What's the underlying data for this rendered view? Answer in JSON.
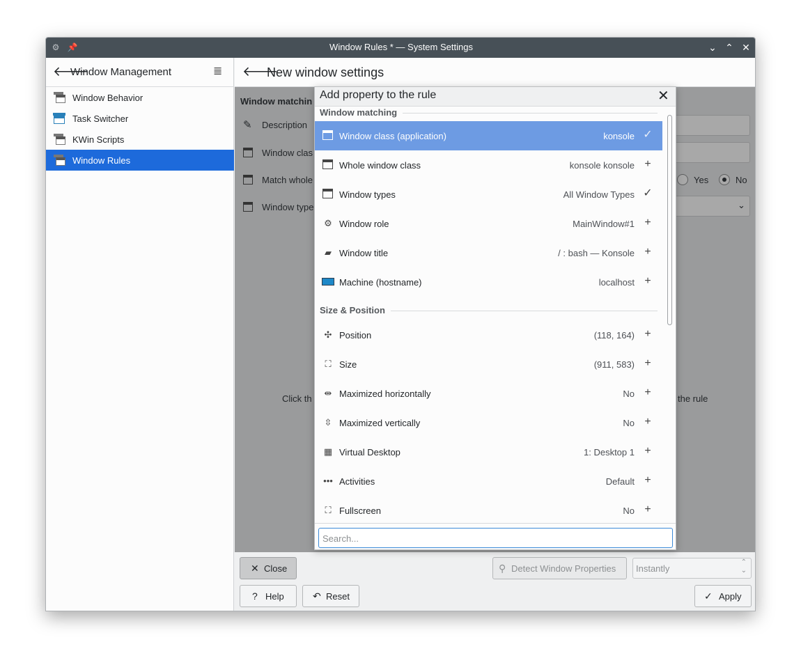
{
  "window": {
    "title": "Window Rules * — System Settings"
  },
  "sidebar": {
    "title": "Window Management",
    "items": [
      {
        "label": "Window Behavior"
      },
      {
        "label": "Task Switcher"
      },
      {
        "label": "KWin Scripts"
      },
      {
        "label": "Window Rules"
      }
    ]
  },
  "main": {
    "title": "New window settings",
    "section_label": "Window matchin",
    "rows": [
      "Description",
      "Window clas",
      "Match whole",
      "Window type"
    ],
    "hint_left": "Click th",
    "hint_right": "the rule",
    "radio_yes": "Yes",
    "radio_no": "No"
  },
  "bottom": {
    "close": "Close",
    "detect": "Detect Window Properties",
    "delay": "Instantly",
    "help": "Help",
    "reset": "Reset",
    "apply": "Apply"
  },
  "dialog": {
    "title": "Add property to the rule",
    "sections": [
      {
        "title": "Window matching"
      },
      {
        "title": "Size & Position"
      }
    ],
    "rows": [
      {
        "label": "Window class (application)",
        "value": "konsole",
        "action": "✓"
      },
      {
        "label": "Whole window class",
        "value": "konsole konsole",
        "action": "+"
      },
      {
        "label": "Window types",
        "value": "All Window Types",
        "action": "✓"
      },
      {
        "label": "Window role",
        "value": "MainWindow#1",
        "action": "+"
      },
      {
        "label": "Window title",
        "value": "/ : bash — Konsole",
        "action": "+"
      },
      {
        "label": "Machine (hostname)",
        "value": "localhost",
        "action": "+"
      },
      {
        "label": "Position",
        "value": "(118, 164)",
        "action": "+"
      },
      {
        "label": "Size",
        "value": "(911, 583)",
        "action": "+"
      },
      {
        "label": "Maximized horizontally",
        "value": "No",
        "action": "+"
      },
      {
        "label": "Maximized vertically",
        "value": "No",
        "action": "+"
      },
      {
        "label": "Virtual Desktop",
        "value": "1: Desktop 1",
        "action": "+"
      },
      {
        "label": "Activities",
        "value": "Default",
        "action": "+"
      },
      {
        "label": "Fullscreen",
        "value": "No",
        "action": "+"
      }
    ],
    "search_placeholder": "Search..."
  }
}
